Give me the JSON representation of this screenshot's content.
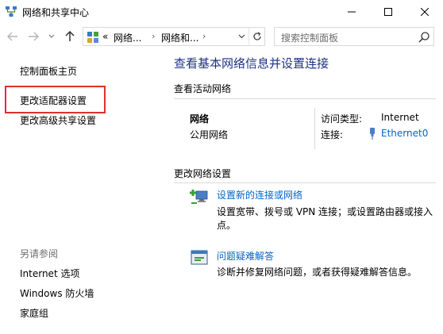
{
  "window": {
    "title": "网络和共享中心"
  },
  "address": {
    "crumb_overflow": "«",
    "crumb1": "网络...",
    "crumb2": "网络和...",
    "chevron": "›"
  },
  "search": {
    "placeholder": "搜索控制面板"
  },
  "left": {
    "home": "控制面板主页",
    "adapter": "更改适配器设置",
    "advanced": "更改高级共享设置",
    "see_also": "另请参阅",
    "internet_options": "Internet 选项",
    "firewall": "Windows 防火墙",
    "homegroup": "家庭组"
  },
  "main": {
    "title": "查看基本网络信息并设置连接",
    "active_networks": "查看活动网络",
    "network_name": "网络",
    "network_type": "公用网络",
    "access_type_label": "访问类型:",
    "access_type_value": "Internet",
    "connection_label": "连接:",
    "connection_value": "Ethernet0",
    "change_settings": "更改网络设置",
    "task1_link": "设置新的连接或网络",
    "task1_desc": "设置宽带、拨号或 VPN 连接；或设置路由器或接入点。",
    "task2_link": "问题疑难解答",
    "task2_desc": "诊断并修复网络问题，或者获得疑难解答信息。"
  },
  "colors": {
    "title_blue": "#1e3287",
    "link_blue": "#0066cc",
    "highlight_red": "#d9332b"
  }
}
